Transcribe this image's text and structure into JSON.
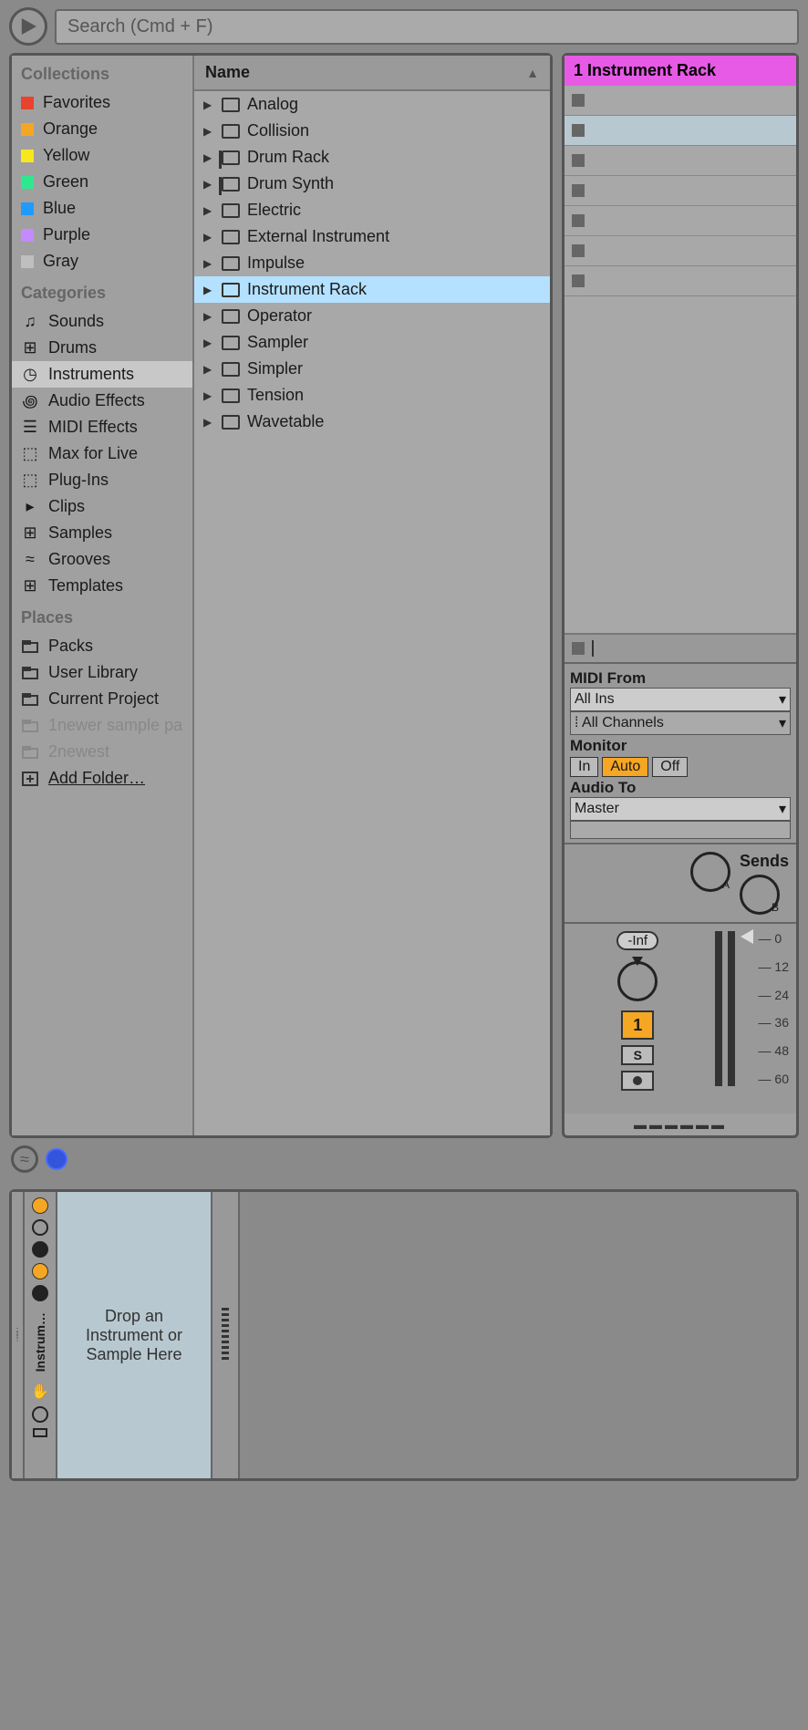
{
  "search": {
    "placeholder": "Search (Cmd + F)"
  },
  "collections": {
    "title": "Collections",
    "items": [
      {
        "label": "Favorites",
        "color": "#e8432e"
      },
      {
        "label": "Orange",
        "color": "#f5a623"
      },
      {
        "label": "Yellow",
        "color": "#f8e71c"
      },
      {
        "label": "Green",
        "color": "#2ee88f"
      },
      {
        "label": "Blue",
        "color": "#1f9bff"
      },
      {
        "label": "Purple",
        "color": "#c48aff"
      },
      {
        "label": "Gray",
        "color": "#bfbfbf"
      }
    ]
  },
  "categories": {
    "title": "Categories",
    "items": [
      {
        "label": "Sounds"
      },
      {
        "label": "Drums"
      },
      {
        "label": "Instruments",
        "selected": true
      },
      {
        "label": "Audio Effects"
      },
      {
        "label": "MIDI Effects"
      },
      {
        "label": "Max for Live"
      },
      {
        "label": "Plug-Ins"
      },
      {
        "label": "Clips"
      },
      {
        "label": "Samples"
      },
      {
        "label": "Grooves"
      },
      {
        "label": "Templates"
      }
    ]
  },
  "places": {
    "title": "Places",
    "items": [
      {
        "label": "Packs"
      },
      {
        "label": "User Library"
      },
      {
        "label": "Current Project"
      },
      {
        "label": "1newer sample pa",
        "disabled": true
      },
      {
        "label": "2newest",
        "disabled": true
      }
    ],
    "add_folder": "Add Folder…"
  },
  "content": {
    "header": "Name",
    "items": [
      {
        "label": "Analog"
      },
      {
        "label": "Collision"
      },
      {
        "label": "Drum Rack",
        "rack": true
      },
      {
        "label": "Drum Synth",
        "rack": true
      },
      {
        "label": "Electric"
      },
      {
        "label": "External Instrument"
      },
      {
        "label": "Impulse"
      },
      {
        "label": "Instrument Rack",
        "selected": true
      },
      {
        "label": "Operator"
      },
      {
        "label": "Sampler"
      },
      {
        "label": "Simpler"
      },
      {
        "label": "Tension"
      },
      {
        "label": "Wavetable"
      }
    ]
  },
  "track": {
    "title": "1 Instrument Rack",
    "slot_count": 7,
    "highlight_slot": 1,
    "io": {
      "midi_from": "MIDI From",
      "all_ins": "All Ins",
      "all_channels": "All Channels",
      "monitor": "Monitor",
      "mon_in": "In",
      "mon_auto": "Auto",
      "mon_off": "Off",
      "audio_to": "Audio To",
      "master": "Master"
    },
    "sends_label": "Sends",
    "mixer": {
      "inf": "-Inf",
      "track_num": "1",
      "solo": "S",
      "db_marks": [
        "0",
        "12",
        "24",
        "36",
        "48",
        "60"
      ]
    }
  },
  "device": {
    "label": "Instrum…",
    "drop_text": "Drop an Instrument or Sample Here"
  }
}
